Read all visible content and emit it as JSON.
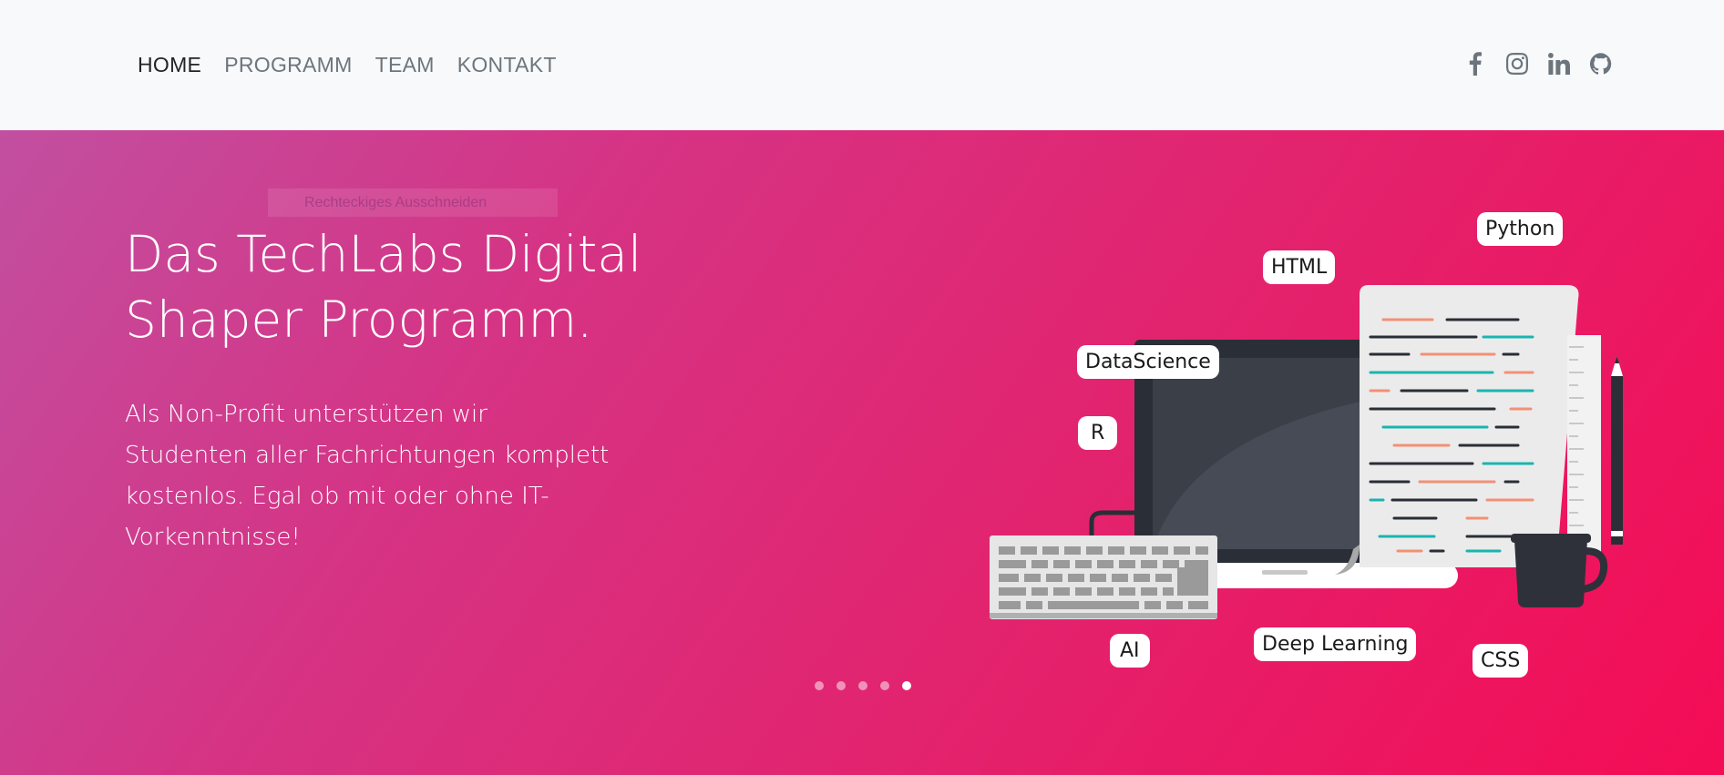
{
  "nav": {
    "items": [
      {
        "label": "HOME",
        "active": true
      },
      {
        "label": "PROGRAMM",
        "active": false
      },
      {
        "label": "TEAM",
        "active": false
      },
      {
        "label": "KONTAKT",
        "active": false
      }
    ],
    "social_icons": [
      "facebook-icon",
      "instagram-icon",
      "linkedin-icon",
      "github-icon"
    ]
  },
  "hero": {
    "tooltip": "Rechteckiges Ausschneiden",
    "title": "Das TechLabs Digital Shaper Programm.",
    "text": "Als Non-Profit unterstützen wir Studenten aller Fachrichtungen komplett kostenlos. Egal ob mit oder ohne IT-Vorkenntnisse!",
    "slides_total": 5,
    "slide_active": 5,
    "tags": {
      "python": "Python",
      "html": "HTML",
      "datascience": "DataScience",
      "r": "R",
      "ai": "AI",
      "deep_learning": "Deep Learning",
      "css": "CSS"
    }
  },
  "colors": {
    "gradient_start": "#c24fa0",
    "gradient_end": "#f40c55",
    "nav_bg": "#f8f9fa",
    "nav_text": "#6c757d"
  }
}
